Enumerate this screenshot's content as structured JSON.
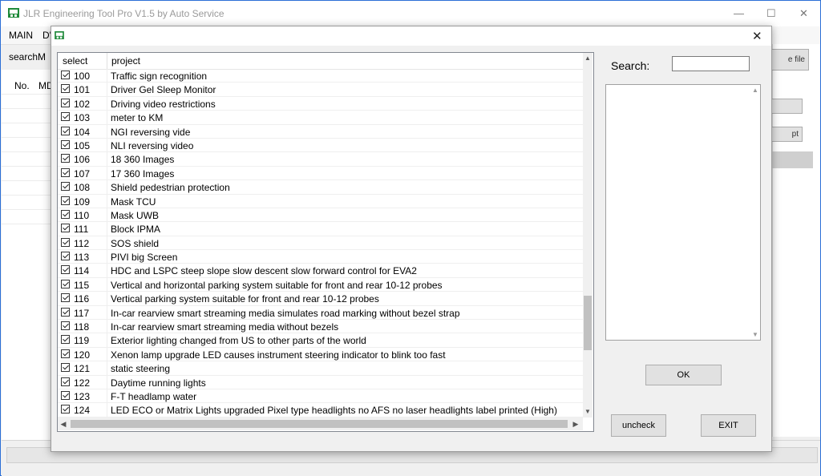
{
  "main_window": {
    "title": "JLR Engineering Tool Pro V1.5 by Auto Service",
    "controls": {
      "minimize": "—",
      "maximize": "☐",
      "close": "✕"
    },
    "menu": [
      "MAIN",
      "D'"
    ],
    "search_label": "searchM",
    "columns": [
      "No.",
      "MD"
    ],
    "right_buttons": [
      "e file",
      "",
      "pt"
    ]
  },
  "dialog": {
    "close_glyph": "✕",
    "grid": {
      "headers": {
        "select": "select",
        "project": "project"
      },
      "rows": [
        {
          "num": "100",
          "project": "Traffic sign recognition",
          "checked": true
        },
        {
          "num": "101",
          "project": "Driver Gel Sleep Monitor",
          "checked": true
        },
        {
          "num": "102",
          "project": "Driving video restrictions",
          "checked": true
        },
        {
          "num": "103",
          "project": "meter to KM",
          "checked": true
        },
        {
          "num": "104",
          "project": "NGI reversing vide",
          "checked": true
        },
        {
          "num": "105",
          "project": "NLI reversing video",
          "checked": true
        },
        {
          "num": "106",
          "project": "18 360 Images",
          "checked": true
        },
        {
          "num": "107",
          "project": "17 360 Images",
          "checked": true
        },
        {
          "num": "108",
          "project": "Shield pedestrian protection",
          "checked": true
        },
        {
          "num": "109",
          "project": "Mask TCU",
          "checked": true
        },
        {
          "num": "110",
          "project": "Mask UWB",
          "checked": true
        },
        {
          "num": "111",
          "project": "Block IPMA",
          "checked": true
        },
        {
          "num": "112",
          "project": "SOS shield",
          "checked": true
        },
        {
          "num": "113",
          "project": "PIVI big Screen",
          "checked": true
        },
        {
          "num": "114",
          "project": "HDC and LSPC steep slope slow descent slow forward control for EVA2",
          "checked": true
        },
        {
          "num": "115",
          "project": "Vertical and horizontal parking system suitable for front and rear 10-12 probes",
          "checked": true
        },
        {
          "num": "116",
          "project": "Vertical parking system suitable for front and rear 10-12 probes",
          "checked": true
        },
        {
          "num": "117",
          "project": "In-car rearview smart streaming media simulates road marking without bezel strap",
          "checked": true
        },
        {
          "num": "118",
          "project": "In-car rearview smart streaming media without bezels",
          "checked": true
        },
        {
          "num": "119",
          "project": "Exterior lighting changed from US to other parts of the world",
          "checked": true
        },
        {
          "num": "120",
          "project": "Xenon lamp upgrade LED causes instrument steering indicator to blink too fast",
          "checked": true
        },
        {
          "num": "121",
          "project": "static steering",
          "checked": true
        },
        {
          "num": "122",
          "project": "Daytime running lights",
          "checked": true
        },
        {
          "num": "123",
          "project": "F-T headlamp water",
          "checked": true
        },
        {
          "num": "124",
          "project": "LED ECO or Matrix Lights upgraded Pixel type headlights no AFS no laser headlights label printed (High)",
          "checked": true
        }
      ]
    },
    "search": {
      "label": "Search:",
      "value": ""
    },
    "buttons": {
      "ok": "OK",
      "uncheck": "uncheck",
      "exit": "EXIT"
    }
  }
}
